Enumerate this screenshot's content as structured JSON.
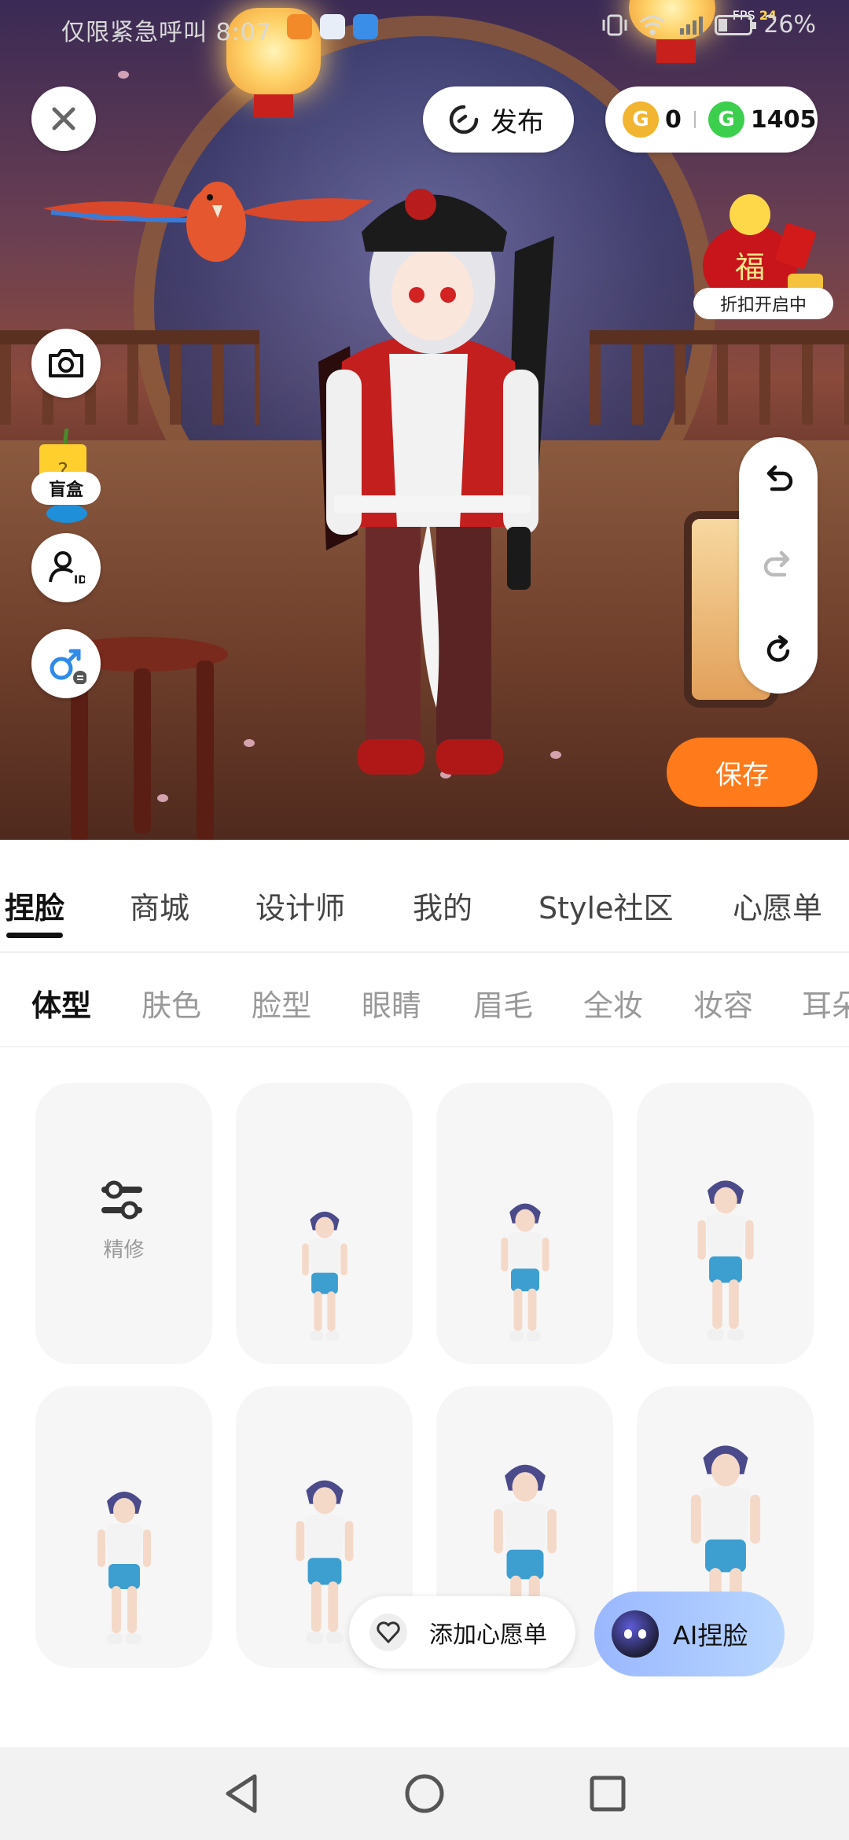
{
  "status_bar": {
    "left_text": "仅限紧急呼叫 8:07",
    "fps_label": "FPS",
    "fps_value": "24",
    "battery": "26%",
    "battery_level": 0.26
  },
  "top": {
    "publish_label": "发布",
    "coin_gold": "0",
    "coin_green": "1405",
    "promo_label": "折扣开启中",
    "promo_glyph": "福"
  },
  "left_tools": {
    "blindbox_label": "盲盒"
  },
  "scene": {
    "save_label": "保存"
  },
  "tabs": [
    {
      "label": "捏脸"
    },
    {
      "label": "商城"
    },
    {
      "label": "设计师"
    },
    {
      "label": "我的"
    },
    {
      "label": "Style社区"
    },
    {
      "label": "心愿单"
    }
  ],
  "subtabs": [
    {
      "label": "体型"
    },
    {
      "label": "肤色"
    },
    {
      "label": "脸型"
    },
    {
      "label": "眼睛"
    },
    {
      "label": "眉毛"
    },
    {
      "label": "全妆"
    },
    {
      "label": "妆容"
    },
    {
      "label": "耳朵"
    }
  ],
  "grid": {
    "refine_label": "精修"
  },
  "floating": {
    "wish_label": "添加心愿单",
    "ai_label": "AI捏脸"
  },
  "colors": {
    "accent": "#ff7a1a",
    "gold_coin": "#f2b531",
    "green_coin": "#3ccf4e",
    "ai_button": "#a8c7ff"
  }
}
